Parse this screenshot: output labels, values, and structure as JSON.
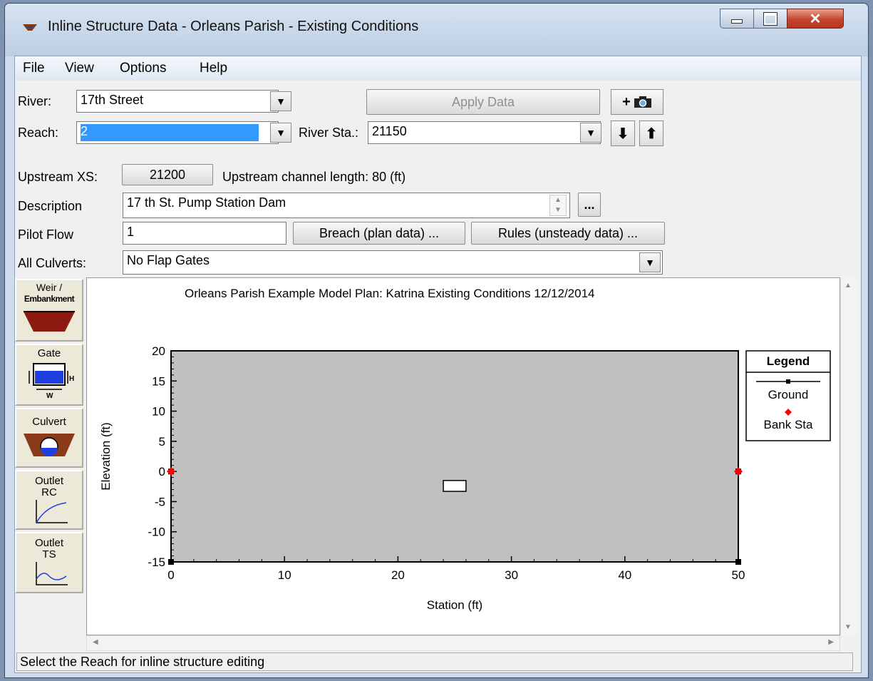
{
  "window": {
    "title": "Inline Structure Data - Orleans Parish - Existing Conditions"
  },
  "menu": {
    "items": [
      "File",
      "View",
      "Options",
      "Help"
    ]
  },
  "form": {
    "river_label": "River:",
    "river_value": "17th Street",
    "apply_label": "Apply Data",
    "reach_label": "Reach:",
    "reach_value": "2",
    "river_sta_label": "River Sta.:",
    "river_sta_value": "21150",
    "upstream_xs_label": "Upstream XS:",
    "upstream_xs_value": "21200",
    "upstream_len_text": "Upstream channel length: 80 (ft)",
    "description_label": "Description",
    "description_value": "17 th St. Pump Station Dam",
    "pilot_flow_label": "Pilot Flow",
    "pilot_flow_value": "1",
    "breach_label": "Breach (plan data) ...",
    "rules_label": "Rules (unsteady data) ...",
    "all_culverts_label": "All Culverts:",
    "all_culverts_value": "No Flap Gates",
    "ellipsis_label": "..."
  },
  "sidebar": {
    "weir": [
      "Weir /",
      "Embankment"
    ],
    "gate": "Gate",
    "culvert": "Culvert",
    "outlet_rc": [
      "Outlet",
      "RC"
    ],
    "outlet_ts": [
      "Outlet",
      "TS"
    ]
  },
  "status": {
    "text": "Select the Reach for inline structure editing"
  },
  "colors": {
    "ground": "#000000",
    "bank_sta": "#ff0000",
    "fill": "#c0c0c0",
    "selection": "#3399ff"
  },
  "chart_data": {
    "type": "line",
    "title": "Orleans Parish Example Model     Plan: Katrina Existing Conditions     12/12/2014",
    "xlabel": "Station (ft)",
    "ylabel": "Elevation (ft)",
    "xlim": [
      0,
      50
    ],
    "ylim": [
      -15,
      20
    ],
    "xticks": [
      0,
      10,
      20,
      30,
      40,
      50
    ],
    "yticks": [
      20,
      15,
      10,
      5,
      0,
      -5,
      -10,
      -15
    ],
    "legend_title": "Legend",
    "legend_position": "right",
    "series": [
      {
        "name": "Ground",
        "color": "#000000",
        "x": [
          0,
          0,
          50,
          50
        ],
        "y": [
          0,
          -15,
          -15,
          0
        ]
      },
      {
        "name": "Bank Sta",
        "color": "#ff0000",
        "x": [
          0,
          50
        ],
        "y": [
          0,
          0
        ]
      }
    ],
    "culvert_box": {
      "x": [
        24,
        26
      ],
      "y": [
        -3.3,
        -1.5
      ]
    }
  }
}
